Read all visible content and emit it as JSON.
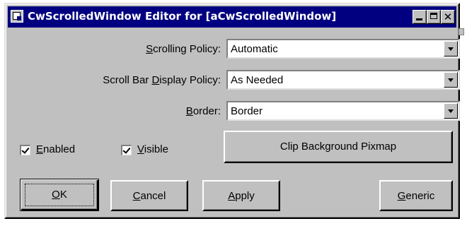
{
  "window": {
    "title": "CwScrolledWindow Editor for [aCwScrolledWindow]",
    "min_label": "",
    "close_label": "✕"
  },
  "fields": {
    "scrolling_policy": {
      "label_pre": "",
      "label_u": "S",
      "label_post": "crolling Policy:",
      "value": "Automatic"
    },
    "scroll_bar_display_policy": {
      "label_pre": "Scroll Bar ",
      "label_u": "D",
      "label_post": "isplay Policy:",
      "value": "As Needed"
    },
    "border": {
      "label_pre": "",
      "label_u": "B",
      "label_post": "order:",
      "value": "Border"
    }
  },
  "checkboxes": {
    "enabled": {
      "label_u": "E",
      "label_post": "nabled",
      "checked": true
    },
    "visible": {
      "label_u": "V",
      "label_post": "isible",
      "checked": true
    }
  },
  "buttons": {
    "clip_background_pixmap": "Clip Background Pixmap",
    "ok": {
      "label_u": "O",
      "label_post": "K"
    },
    "cancel": {
      "label_u": "C",
      "label_post": "ancel"
    },
    "apply": {
      "label_u": "A",
      "label_post": "pply"
    },
    "generic": {
      "label_u": "G",
      "label_post": "eneric"
    }
  },
  "colors": {
    "titlebar": "#000080",
    "face": "#c0c0c0"
  }
}
